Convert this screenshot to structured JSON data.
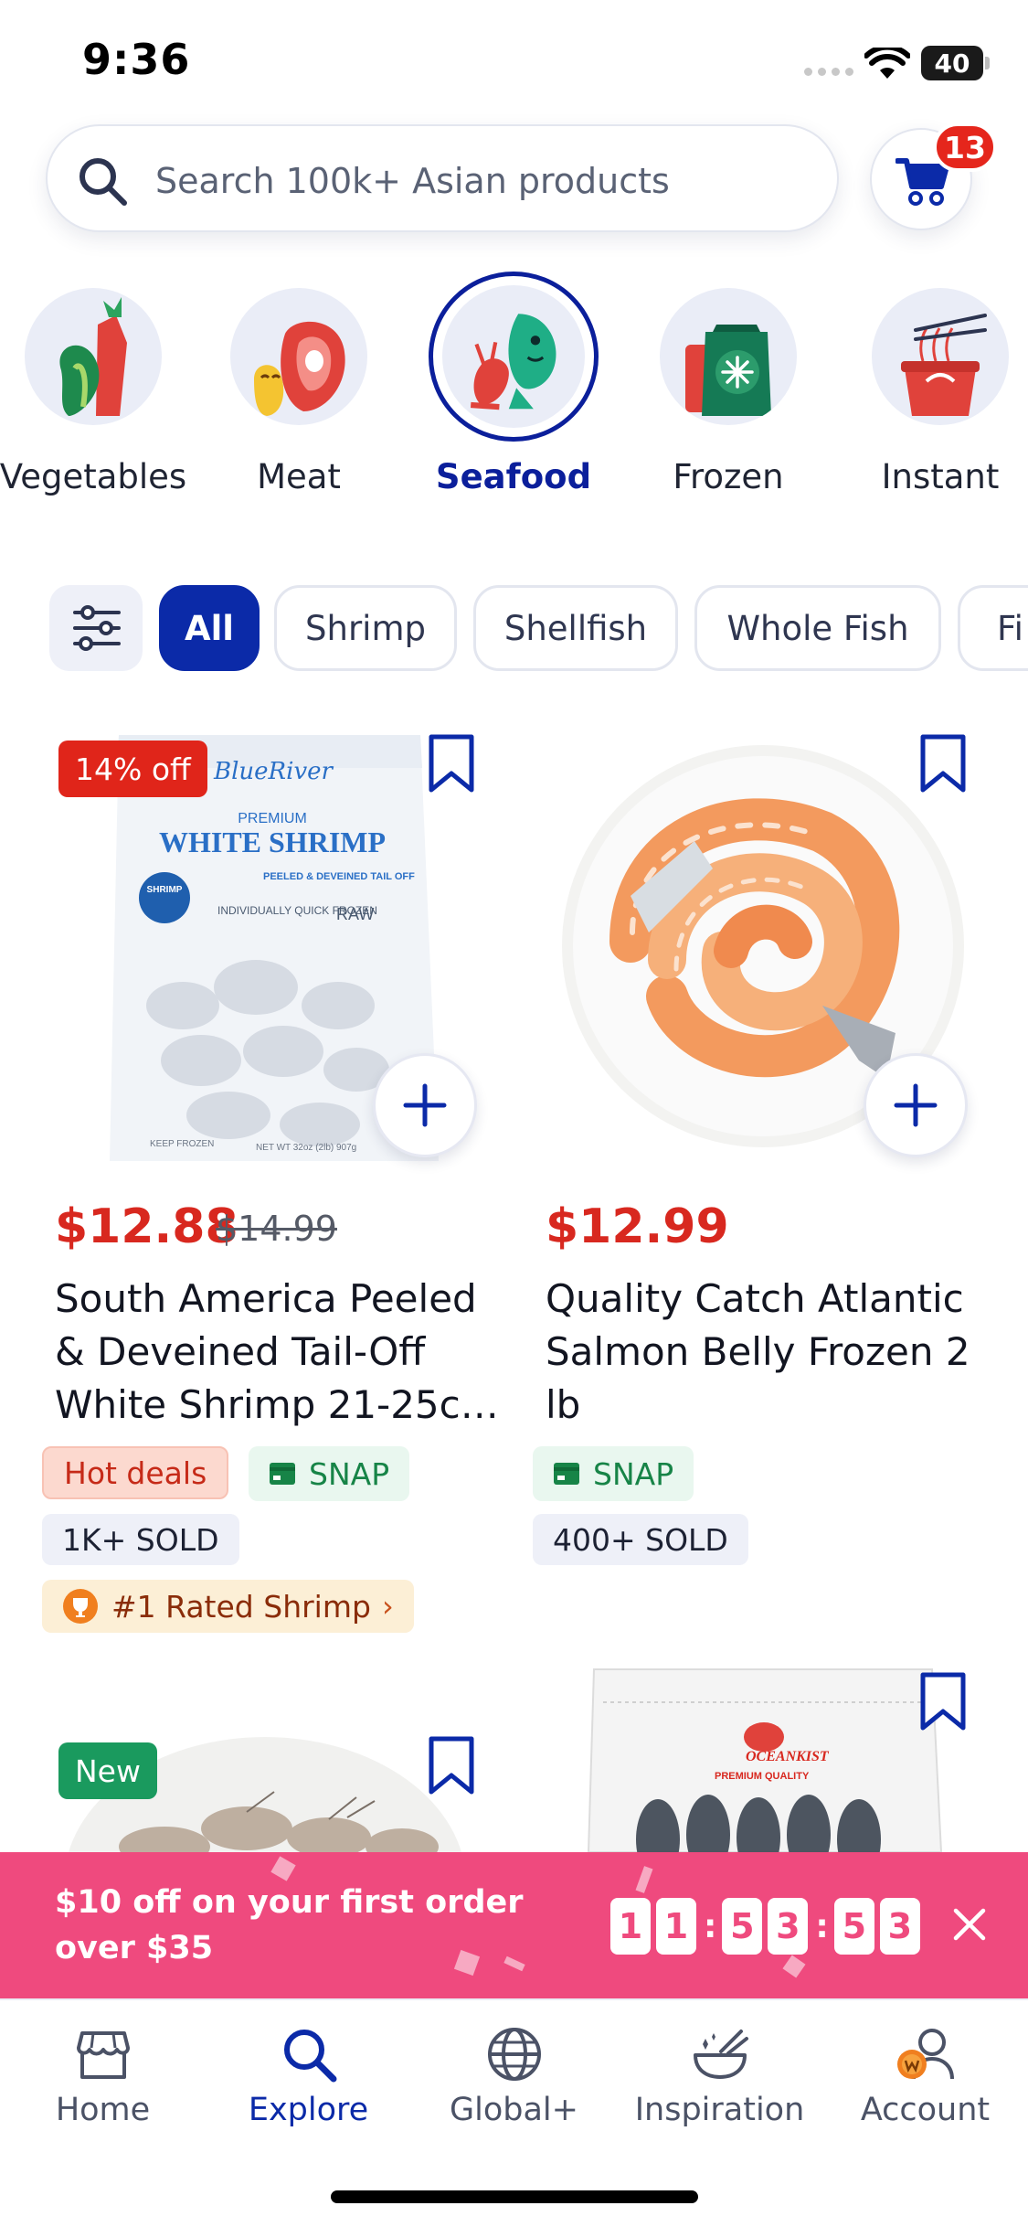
{
  "status_bar": {
    "time": "9:36",
    "battery": "40"
  },
  "search": {
    "placeholder": "Search 100k+ Asian products"
  },
  "cart": {
    "badge_count": "13"
  },
  "categories": [
    {
      "label": "Vegetables"
    },
    {
      "label": "Meat"
    },
    {
      "label": "Seafood",
      "active": true
    },
    {
      "label": "Frozen"
    },
    {
      "label": "Instant"
    }
  ],
  "filters": [
    {
      "label": "All",
      "active": true
    },
    {
      "label": "Shrimp"
    },
    {
      "label": "Shellfish"
    },
    {
      "label": "Whole Fish"
    },
    {
      "label": "Fi"
    }
  ],
  "products": [
    {
      "discount_badge": "14% off",
      "price": "$12.88",
      "old_price": "$14.99",
      "title": "South America Peeled & Deveined Tail-Off White Shrimp 21-25c…",
      "tags": {
        "hot": "Hot deals",
        "snap": "SNAP",
        "sold": "1K+ SOLD"
      },
      "rated": "#1 Rated Shrimp",
      "package": {
        "brand": "BlueRiver",
        "line1": "PREMIUM",
        "line2": "WHITE SHRIMP",
        "line3": "PEELED & DEVEINED TAIL OFF",
        "line4": "INDIVIDUALLY QUICK FROZEN",
        "line5": "RAW",
        "line6": "KEEP FROZEN",
        "line7": "NET WT 32oz (2lb) 907g",
        "seal": "SHRIMP"
      }
    },
    {
      "price": "$12.99",
      "title": "Quality Catch Atlantic Salmon Belly Frozen 2 lb",
      "tags": {
        "snap": "SNAP",
        "sold": "400+ SOLD"
      }
    },
    {
      "new_badge": "New"
    },
    {
      "package": {
        "brand": "OCEANKIST",
        "line1": "PREMIUM QUALITY"
      }
    }
  ],
  "promo": {
    "text": "$10 off on your first order over $35",
    "countdown": [
      "1",
      "1",
      "5",
      "3",
      "5",
      "3"
    ]
  },
  "nav": [
    {
      "label": "Home"
    },
    {
      "label": "Explore",
      "active": true
    },
    {
      "label": "Global+"
    },
    {
      "label": "Inspiration"
    },
    {
      "label": "Account"
    }
  ],
  "colors": {
    "brand_blue": "#0b2aa8",
    "price_red": "#d8281f",
    "promo_pink": "#ef4a7e",
    "snap_green": "#178447"
  }
}
